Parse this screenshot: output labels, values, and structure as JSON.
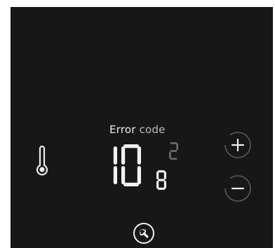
{
  "display": {
    "label_main": "Error",
    "label_secondary": "code",
    "code_large": "10",
    "code_small_top": "2",
    "code_small_bottom": "8"
  },
  "colors": {
    "panel_background": "#171717",
    "digit_lit": "#f2f2f2",
    "digit_dim": "#6a6a6a",
    "label_text": "#ececec"
  },
  "icons": {
    "temperature": "thermometer-icon",
    "increase": "plus-icon",
    "decrease": "minus-icon",
    "service": "wrench-icon"
  }
}
